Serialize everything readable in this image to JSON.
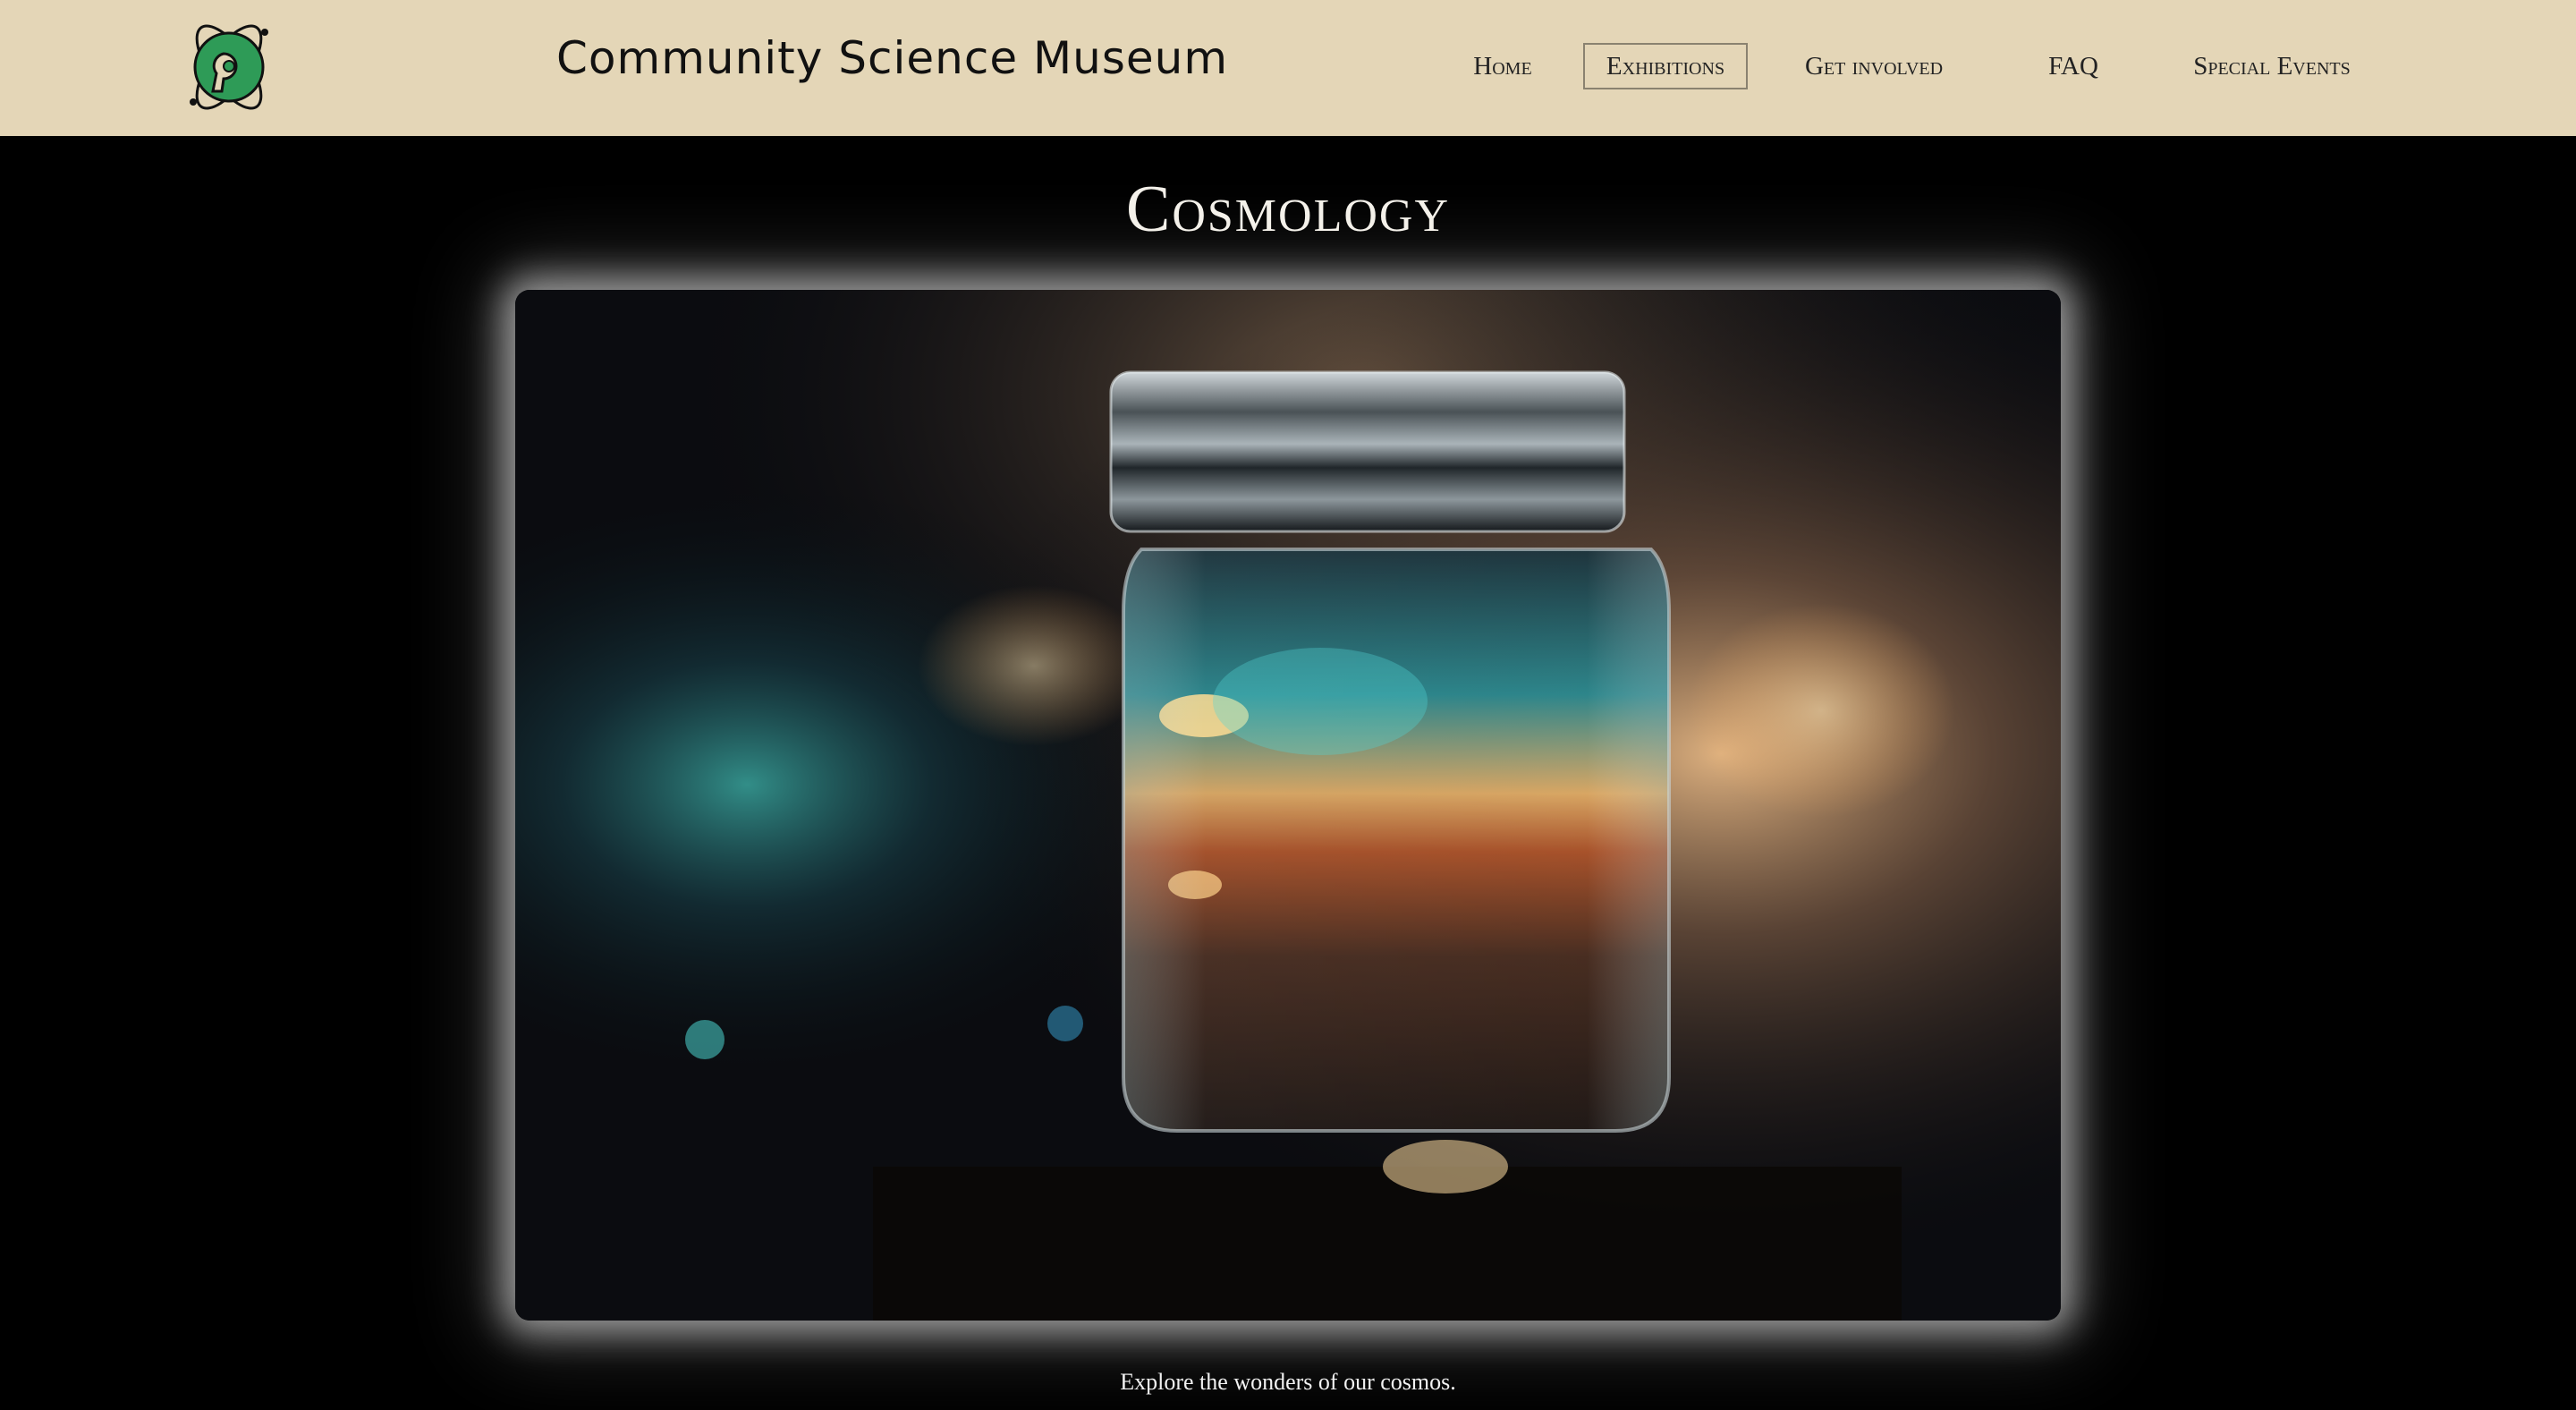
{
  "header": {
    "site_title": "Community Science Museum",
    "logo_icon": "atom-logo-icon",
    "colors": {
      "background": "#e4d6b7",
      "logo_green": "#2e9b57"
    }
  },
  "nav": {
    "items": [
      {
        "label": "Home",
        "active": false
      },
      {
        "label": "Exhibitions",
        "active": true
      },
      {
        "label": "Get involved",
        "active": false
      },
      {
        "label": "FAQ",
        "active": false
      },
      {
        "label": "Special Events",
        "active": false
      }
    ]
  },
  "main": {
    "heading": "Cosmology",
    "hero_image": "galaxy-in-jar-image",
    "caption": "Explore the wonders of our cosmos."
  }
}
